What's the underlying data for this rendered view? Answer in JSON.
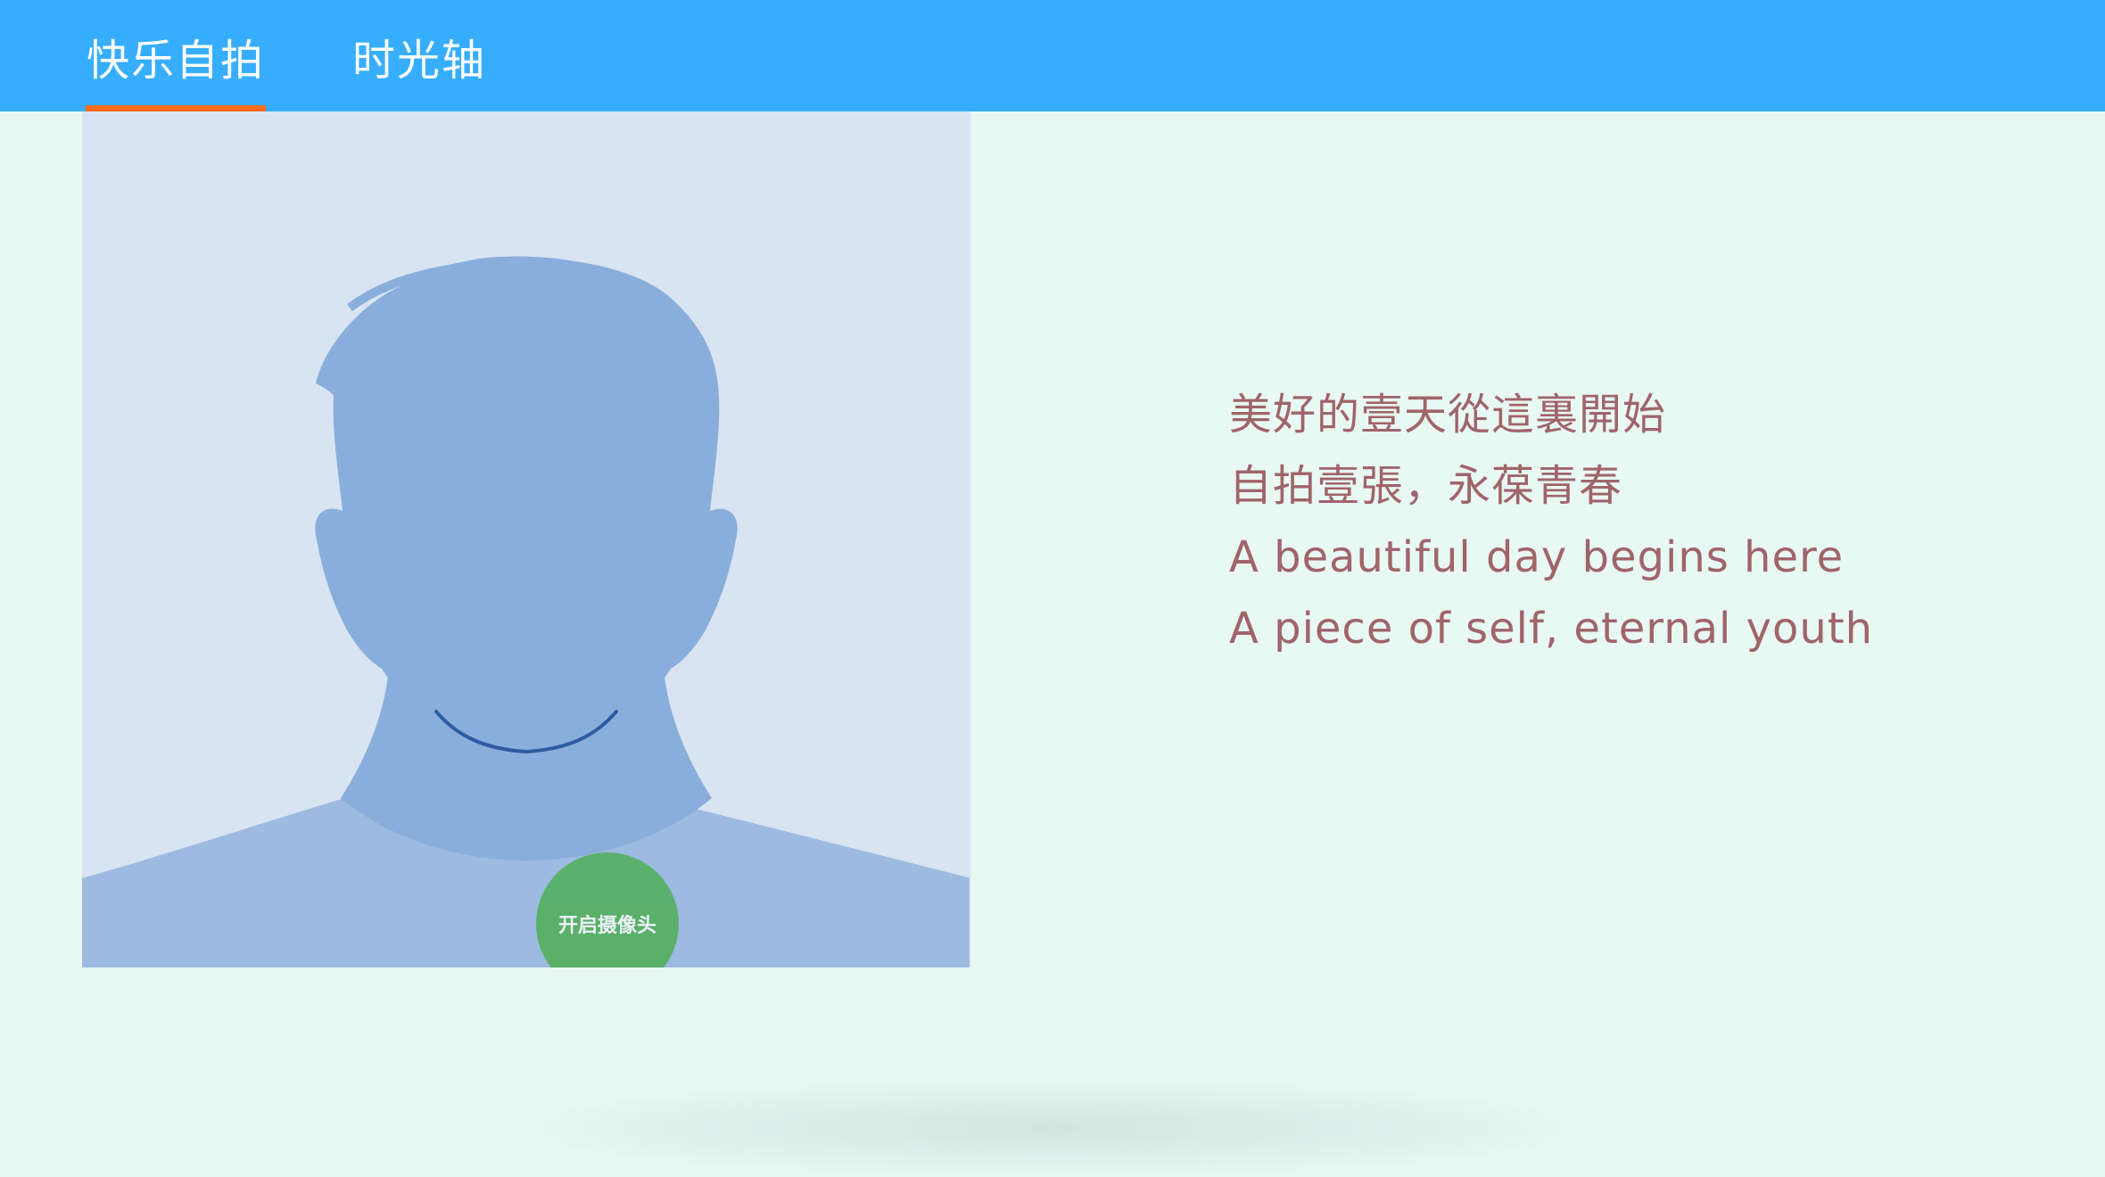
{
  "header": {
    "tabs": [
      {
        "label": "快乐自拍",
        "active": true
      },
      {
        "label": "时光轴",
        "active": false
      }
    ]
  },
  "photo": {
    "camera_button_label": "开启摄像头"
  },
  "quotes": [
    "美好的壹天從這裏開始",
    "自拍壹張，永葆青春",
    "A beautiful day begins here",
    "A piece of self, eternal youth"
  ],
  "colors": {
    "header_bg": "#37AEFD",
    "active_tab_indicator": "#FF6A1A",
    "page_bg": "#E8F8F3",
    "photo_bg": "#D8E4F2",
    "silhouette_main": "#8AAEDB",
    "silhouette_shoulders": "#9DBAE0",
    "chin_line": "#2E5CA3",
    "camera_button": "#4CAF50",
    "quote_text": "#A0646A"
  },
  "icons": {
    "avatar": "person-silhouette-icon"
  }
}
